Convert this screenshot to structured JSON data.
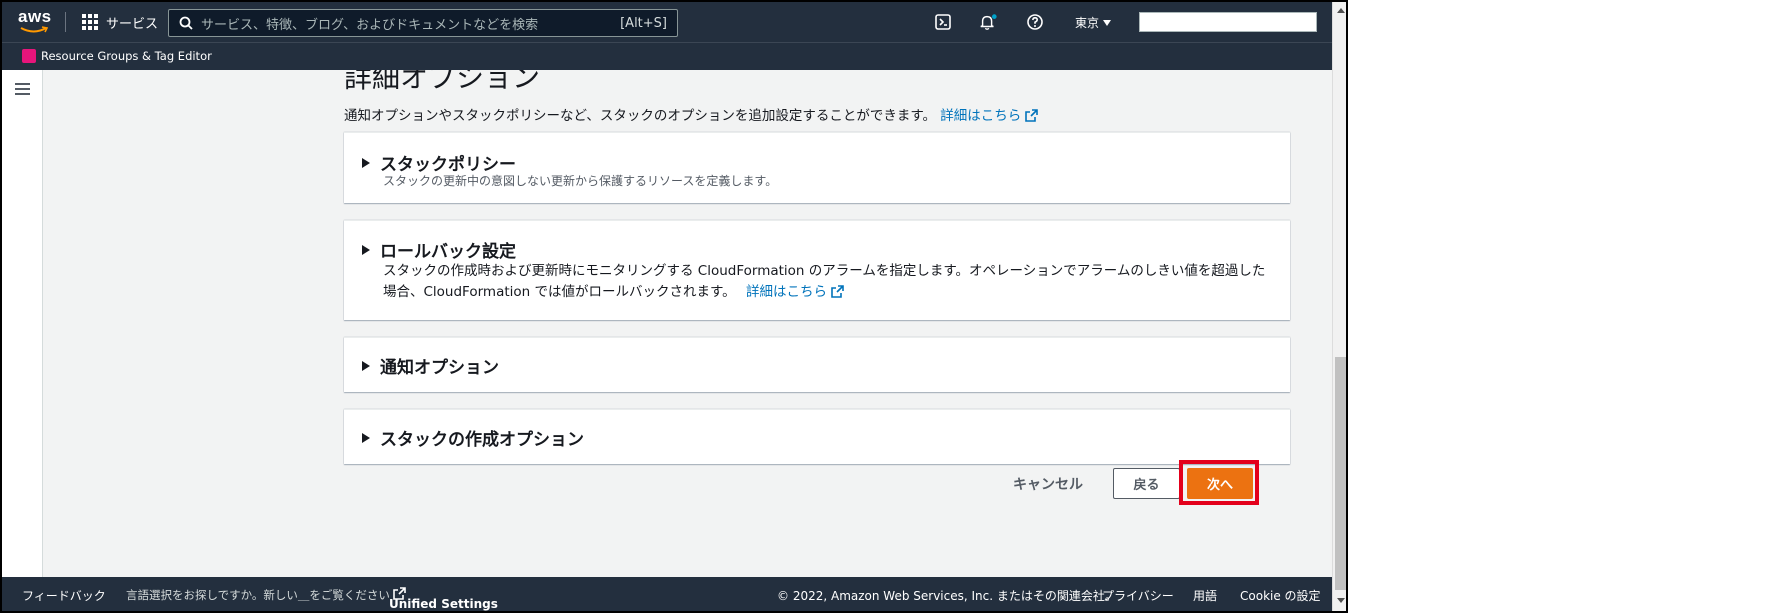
{
  "header": {
    "logo_text": "aws",
    "services_label": "サービス",
    "search_placeholder": "サービス、特徴、ブログ、およびドキュメントなどを検索",
    "search_shortcut": "[Alt+S]",
    "region_label": "東京",
    "account_value": ""
  },
  "subnav": {
    "favorite_label": "Resource Groups & Tag Editor"
  },
  "page": {
    "title": "詳細オプション",
    "description": "通知オプションやスタックポリシーなど、スタックのオプションを追加設定することができます。",
    "learn_more": "詳細はこちら"
  },
  "panels": [
    {
      "title": "スタックポリシー",
      "subtitle": "スタックの更新中の意図しない更新から保護するリソースを定義します。"
    },
    {
      "title": "ロールバック設定",
      "description": "スタックの作成時および更新時にモニタリングする CloudFormation のアラームを指定します。オペレーションでアラームのしきい値を超過した場合、CloudFormation では値がロールバックされます。",
      "learn_more": "詳細はこちら"
    },
    {
      "title": "通知オプション"
    },
    {
      "title": "スタックの作成オプション"
    }
  ],
  "actions": {
    "cancel_label": "キャンセル",
    "back_label": "戻る",
    "next_label": "次へ"
  },
  "footer": {
    "feedback": "フィードバック",
    "language_prompt": "言語選択をお探しですか。新しい＿をご覧ください",
    "unified_settings": "Unified Settings",
    "copyright": "© 2022, Amazon Web Services, Inc. またはその関連会社。",
    "privacy": "プライバシー",
    "terms": "用語",
    "cookie": "Cookie の設定"
  },
  "colors": {
    "nav_bg": "#232f3e",
    "primary_button": "#ec7211",
    "link": "#0073bb",
    "highlight": "#e3001b",
    "notification_dot": "#00a1c9"
  }
}
